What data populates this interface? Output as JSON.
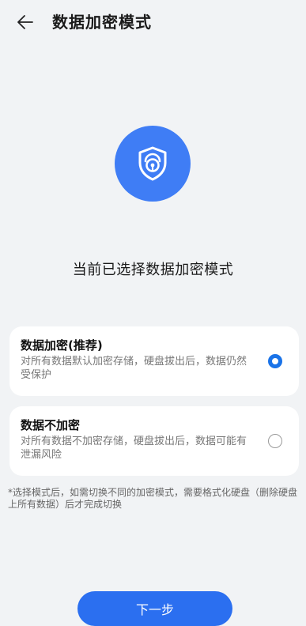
{
  "header": {
    "back_icon": "arrow-left-icon",
    "title": "数据加密模式"
  },
  "hero": {
    "icon": "shield-lock-icon",
    "icon_bg": "#3f7df5",
    "status": "当前已选择数据加密模式"
  },
  "options": [
    {
      "title": "数据加密(推荐)",
      "description": "对所有数据默认加密存储，硬盘拔出后，数据仍然受保护",
      "selected": true
    },
    {
      "title": "数据不加密",
      "description": "对所有数据不加密存储，硬盘拔出后，数据可能有泄漏风险",
      "selected": false
    }
  ],
  "note": "*选择模式后，如需切换不同的加密模式，需要格式化硬盘（删除硬盘上所有数据）后才完成切换",
  "footer": {
    "next_label": "下一步",
    "accent": "#2b6ff0"
  }
}
